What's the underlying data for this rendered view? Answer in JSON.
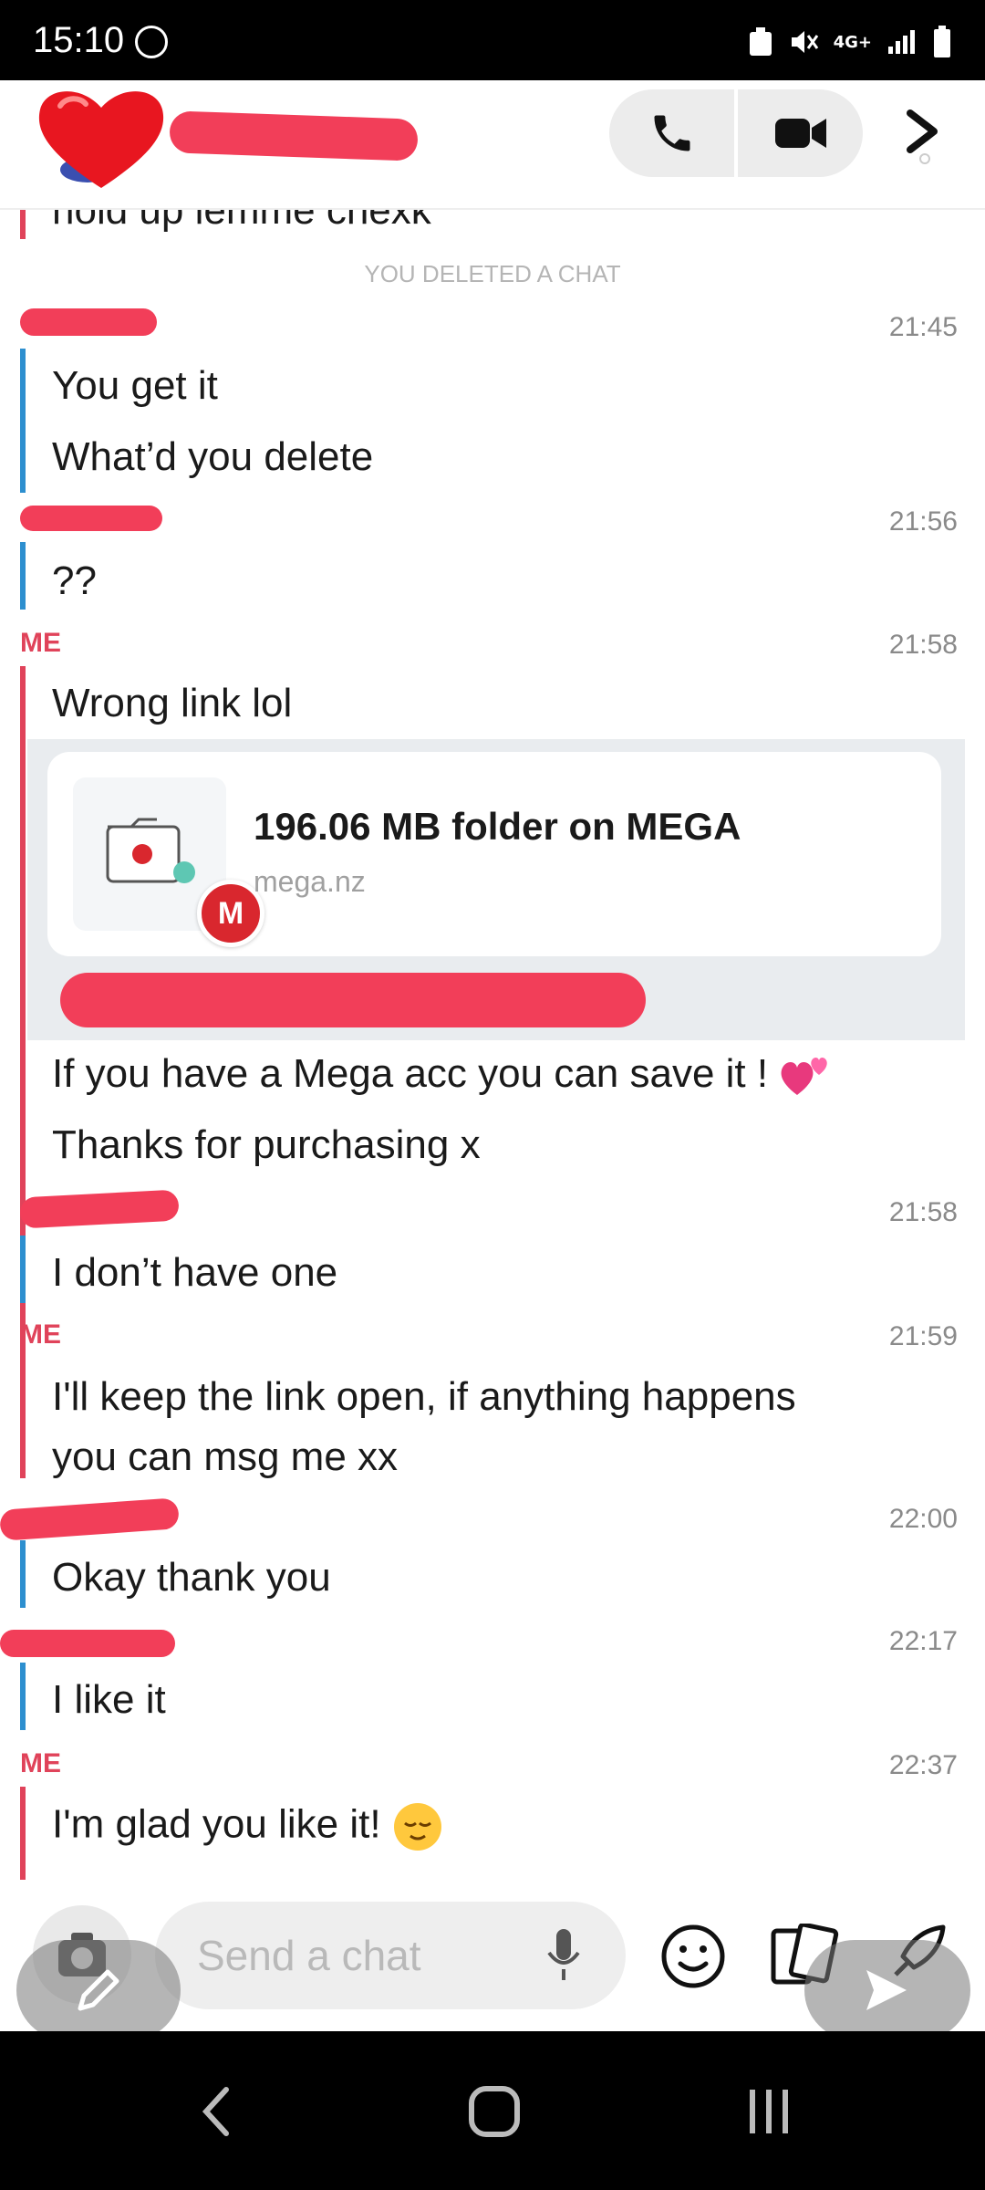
{
  "status_bar": {
    "time": "15:10",
    "network": "4G+"
  },
  "header": {
    "call_icon": "phone-icon",
    "video_icon": "video-camera-icon",
    "more_icon": "chevron-right-icon"
  },
  "chat": {
    "cut_off_text": "hold up lemme chexk",
    "deleted_notice": "YOU DELETED A CHAT",
    "me_label": "ME",
    "messages": [
      {
        "time": "21:45",
        "lines": [
          "You get it",
          "What’d you delete"
        ]
      },
      {
        "time": "21:56",
        "lines": [
          "??"
        ]
      },
      {
        "time": "21:58",
        "line1": "Wrong link lol",
        "link_card": {
          "title": "196.06 MB folder on MEGA",
          "url": "mega.nz",
          "badge": "M"
        },
        "after_card": [
          "If you have a Mega acc you can save it !",
          "Thanks for purchasing x"
        ]
      },
      {
        "time": "21:58",
        "lines": [
          "I don’t have one"
        ]
      },
      {
        "time": "21:59",
        "lines": [
          "I'll keep the link open, if anything happens",
          "you can msg me xx"
        ]
      },
      {
        "time": "22:00",
        "lines": [
          "Okay thank you"
        ]
      },
      {
        "time": "22:17",
        "lines": [
          "I like it"
        ]
      },
      {
        "time": "22:37",
        "lines": [
          "I'm glad you like it!"
        ]
      }
    ]
  },
  "composer": {
    "placeholder": "Send a chat"
  },
  "colors": {
    "me": "#e0435a",
    "friend": "#2d8fcf",
    "redaction": "#f23e59"
  }
}
